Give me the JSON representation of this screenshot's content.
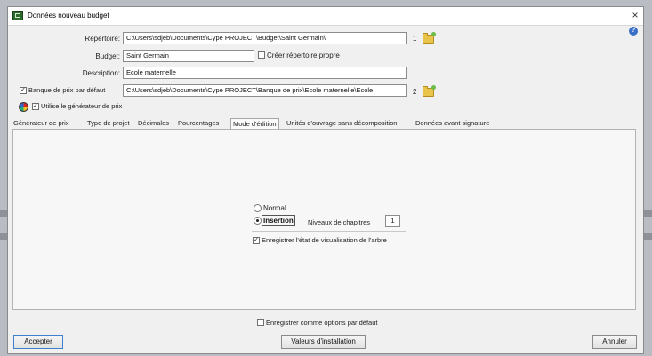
{
  "dialog": {
    "title": "Données nouveau budget",
    "close_glyph": "×",
    "help_glyph": "?"
  },
  "form": {
    "repertoire": {
      "label": "Répertoire:",
      "value": "C:\\Users\\sdjeb\\Documents\\Cype PROJECT\\Budget\\Saint Germain\\",
      "index": "1"
    },
    "budget": {
      "label": "Budget:",
      "value": "Saint Germain"
    },
    "creer_repertoire": {
      "label": "Créer répertoire propre",
      "checked": false
    },
    "description": {
      "label": "Description:",
      "value": "Ecole maternelle"
    },
    "banque": {
      "label": "Banque de prix par défaut",
      "checked": true,
      "value": "C:\\Users\\sdjeb\\Documents\\Cype PROJECT\\Banque de prix\\Ecole maternelle\\Ecole",
      "index": "2"
    },
    "generateur": {
      "label": "Utilise le générateur de prix",
      "checked": true
    }
  },
  "tabs": [
    {
      "label": "Générateur de prix"
    },
    {
      "label": "Type de projet"
    },
    {
      "label": "Décimales"
    },
    {
      "label": "Pourcentages"
    },
    {
      "label": "Mode d'édition",
      "active": true
    },
    {
      "label": "Unités d'ouvrage sans décomposition"
    },
    {
      "label": "Données avant signature"
    }
  ],
  "mode_edition": {
    "normal_label": "Normal",
    "insertion_label": "Insertion",
    "selected": "Insertion",
    "niveaux_label": "Niveaux de chapitres",
    "niveaux_value": "1",
    "enregistrer_etat_label": "Enregistrer l'état de visualisation de l'arbre",
    "enregistrer_etat_checked": true
  },
  "footer": {
    "options_defaut_label": "Enregistrer comme options par défaut",
    "options_defaut_checked": false,
    "accepter": "Accepter",
    "valeurs_installation": "Valeurs d'installation",
    "annuler": "Annuler"
  },
  "icons": {
    "title": "budget-app-icon",
    "folder": "open-folder-icon",
    "generator": "price-generator-icon"
  }
}
